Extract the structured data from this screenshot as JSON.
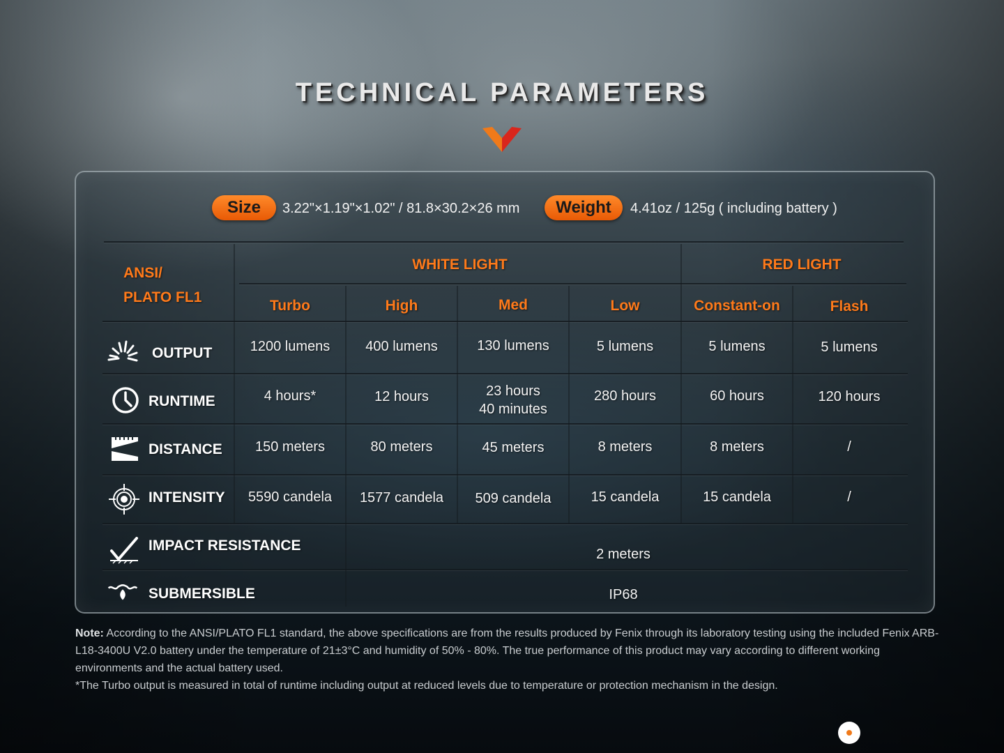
{
  "title": "TECHNICAL PARAMETERS",
  "specs": {
    "size_label": "Size",
    "size_value": "3.22\"×1.19\"×1.02\" / 81.8×30.2×26 mm",
    "weight_label": "Weight",
    "weight_value": "4.41oz / 125g ( including battery )"
  },
  "table": {
    "standard_line1": "ANSI/",
    "standard_line2": "PLATO FL1",
    "group_white": "WHITE LIGHT",
    "group_red": "RED LIGHT",
    "modes": [
      "Turbo",
      "High",
      "Med",
      "Low",
      "Constant-on",
      "Flash"
    ],
    "rows": [
      {
        "label": "OUTPUT",
        "icon": "burst-icon",
        "values": [
          "1200 lumens",
          "400 lumens",
          "130 lumens",
          "5 lumens",
          "5 lumens",
          "5 lumens"
        ]
      },
      {
        "label": "RUNTIME",
        "icon": "clock-icon",
        "values": [
          "4 hours*",
          "12 hours",
          "23 hours\n40 minutes",
          "280 hours",
          "60 hours",
          "120 hours"
        ]
      },
      {
        "label": "DISTANCE",
        "icon": "beam-distance-icon",
        "values": [
          "150 meters",
          "80 meters",
          "45 meters",
          "8 meters",
          "8 meters",
          "/"
        ]
      },
      {
        "label": "INTENSITY",
        "icon": "target-icon",
        "values": [
          "5590 candela",
          "1577 candela",
          "509 candela",
          "15 candela",
          "15 candela",
          "/"
        ]
      }
    ],
    "impact": {
      "label": "IMPACT RESISTANCE",
      "icon": "impact-check-icon",
      "value": "2 meters"
    },
    "submersible": {
      "label": "SUBMERSIBLE",
      "icon": "water-drop-icon",
      "value": "IP68"
    }
  },
  "note": {
    "prefix": "Note:",
    "text": " According to the ANSI/PLATO FL1 standard, the above specifications are from the results produced by Fenix through its laboratory testing using the included Fenix ARB-L18-3400U V2.0 battery under the temperature of 21±3°C and humidity of 50% - 80%. The true performance of this product may vary according to different working environments and the actual battery used.",
    "footnote": "*The Turbo output is measured in total of runtime including output at reduced levels due to temperature or protection mechanism in the design."
  },
  "colors": {
    "accent": "#ff7a1a",
    "chevron_left": "#f07a1a",
    "chevron_right": "#d9261c"
  }
}
